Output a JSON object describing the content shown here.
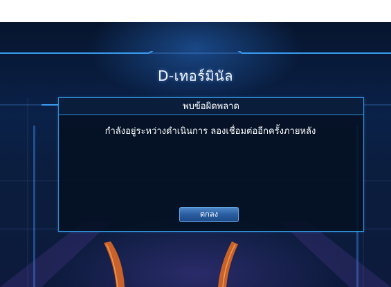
{
  "screen": {
    "title": "D-เทอร์มินัล"
  },
  "dialog": {
    "header": "พบข้อผิดพลาด",
    "message": "กำลังอยู่ระหว่างดำเนินการ ลองเชื่อมต่ออีกครั้งภายหลัง",
    "ok_label": "ตกลง"
  },
  "colors": {
    "dialog_border": "#2f8fd6",
    "button_fill": "#2a5da0",
    "background": "#0a2148"
  }
}
